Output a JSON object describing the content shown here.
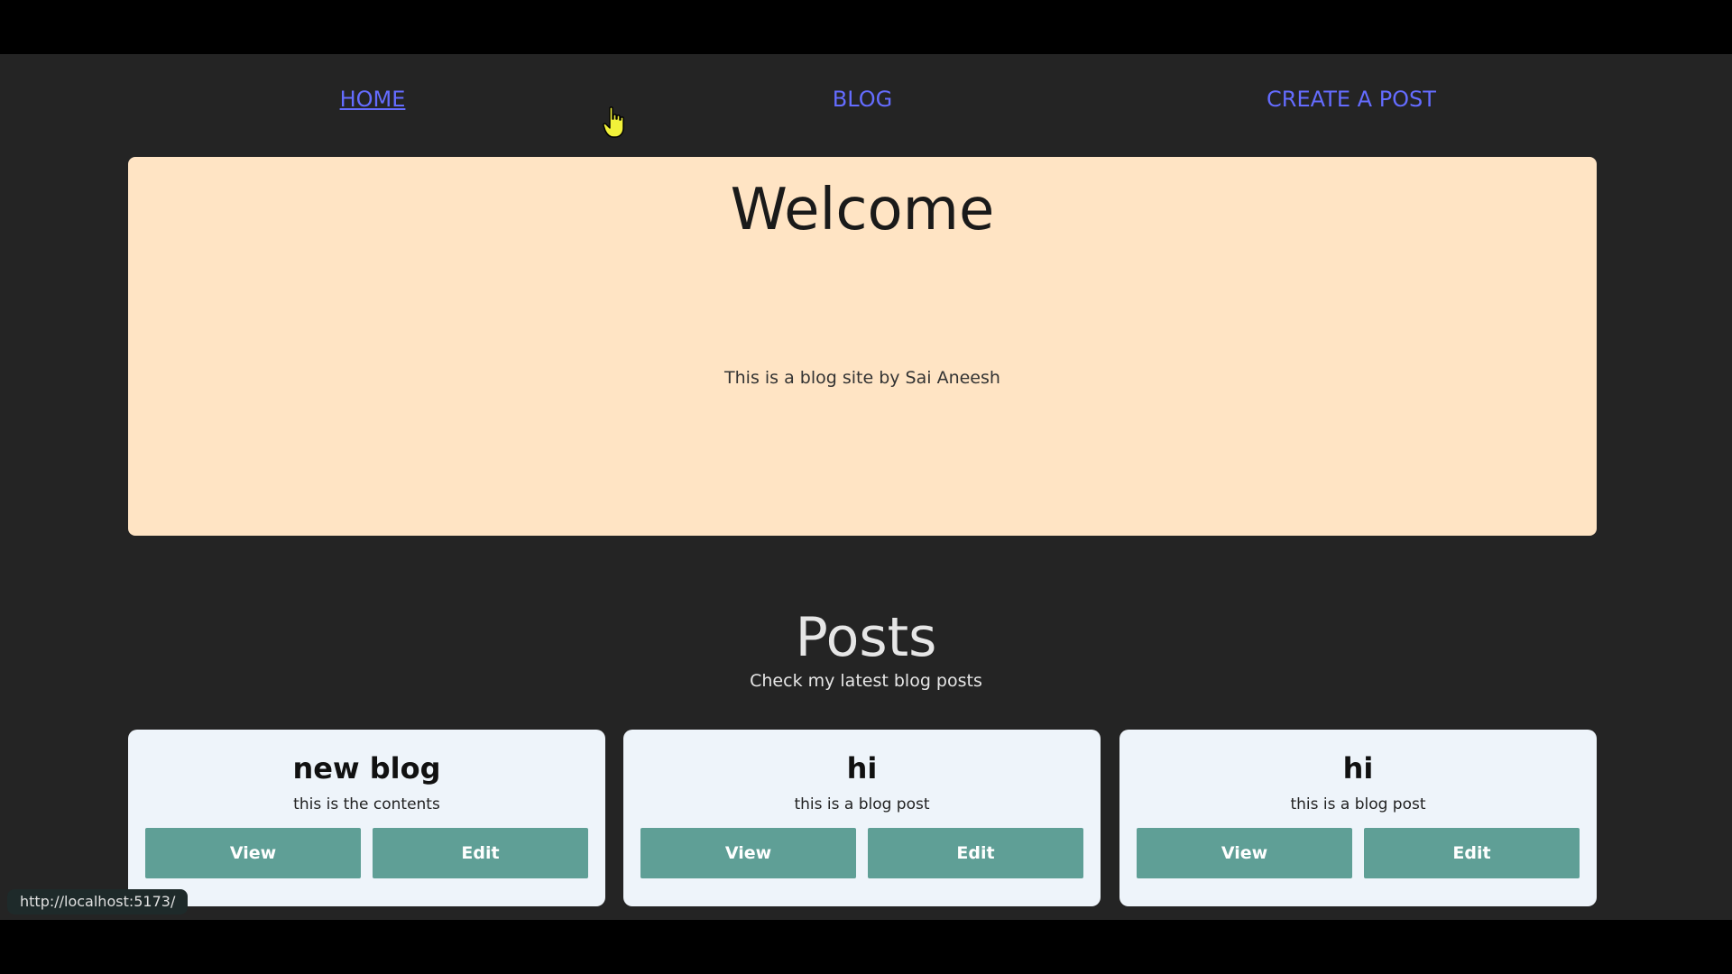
{
  "nav": {
    "home": "HOME",
    "blog": "BLOG",
    "create": "CREATE A POST"
  },
  "hero": {
    "title": "Welcome",
    "subtitle": "This is a blog site by Sai Aneesh"
  },
  "posts": {
    "title": "Posts",
    "subtitle": "Check my latest blog posts",
    "items": [
      {
        "title": "new blog",
        "body": "this is the contents",
        "view_label": "View",
        "edit_label": "Edit"
      },
      {
        "title": "hi",
        "body": "this is a blog post",
        "view_label": "View",
        "edit_label": "Edit"
      },
      {
        "title": "hi",
        "body": "this is a blog post",
        "view_label": "View",
        "edit_label": "Edit"
      }
    ]
  },
  "status_bar": {
    "url": "http://localhost:5173/"
  },
  "colors": {
    "page_bg": "#242424",
    "link": "#646cff",
    "hero_bg": "#ffe4c4",
    "card_bg": "#eef4fa",
    "button_bg": "#5f9f96"
  },
  "icons": {
    "cursor": "hand-pointer-icon"
  }
}
